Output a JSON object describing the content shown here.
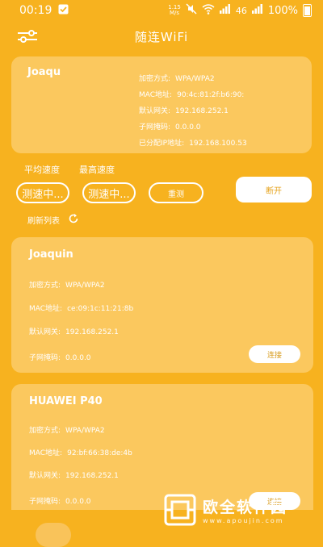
{
  "status_bar": {
    "time": "00:19",
    "net_speed_value": "1.15",
    "net_speed_unit": "M/s",
    "signal_label": "46",
    "battery": "100%"
  },
  "header": {
    "title": "随连WiFi"
  },
  "current": {
    "ssid": "Joaqu",
    "rows": [
      {
        "label": "加密方式:",
        "value": "WPA/WPA2"
      },
      {
        "label": "MAC地址:",
        "value": "90:4c:81:2f:b6:90:"
      },
      {
        "label": "默认网关:",
        "value": "192.168.252.1"
      },
      {
        "label": "子网掩码:",
        "value": "0.0.0.0"
      },
      {
        "label": "已分配IP地址:",
        "value": "192.168.100.53"
      }
    ]
  },
  "speed": {
    "avg_label": "平均速度",
    "max_label": "最高速度",
    "avg_value": "测速中...",
    "max_value": "测速中...",
    "retest_label": "重测",
    "disconnect_label": "断开"
  },
  "refresh": {
    "label": "刷新列表"
  },
  "networks": [
    {
      "ssid": "Joaquin",
      "rows": [
        {
          "label": "加密方式:",
          "value": "WPA/WPA2"
        },
        {
          "label": "MAC地址:",
          "value": "ce:09:1c:11:21:8b"
        },
        {
          "label": "默认网关:",
          "value": "192.168.252.1"
        },
        {
          "label": "子网掩码:",
          "value": "0.0.0.0"
        }
      ],
      "button": "连接"
    },
    {
      "ssid": "HUAWEI P40",
      "rows": [
        {
          "label": "加密方式:",
          "value": "WPA/WPA2"
        },
        {
          "label": "MAC地址:",
          "value": "92:bf:66:38:de:4b"
        },
        {
          "label": "默认网关:",
          "value": "192.168.252.1"
        },
        {
          "label": "子网掩码:",
          "value": "0.0.0.0"
        }
      ],
      "button": "连接"
    }
  ],
  "watermark": {
    "title": "欧全软件园",
    "url": "www.apoujin.com"
  }
}
